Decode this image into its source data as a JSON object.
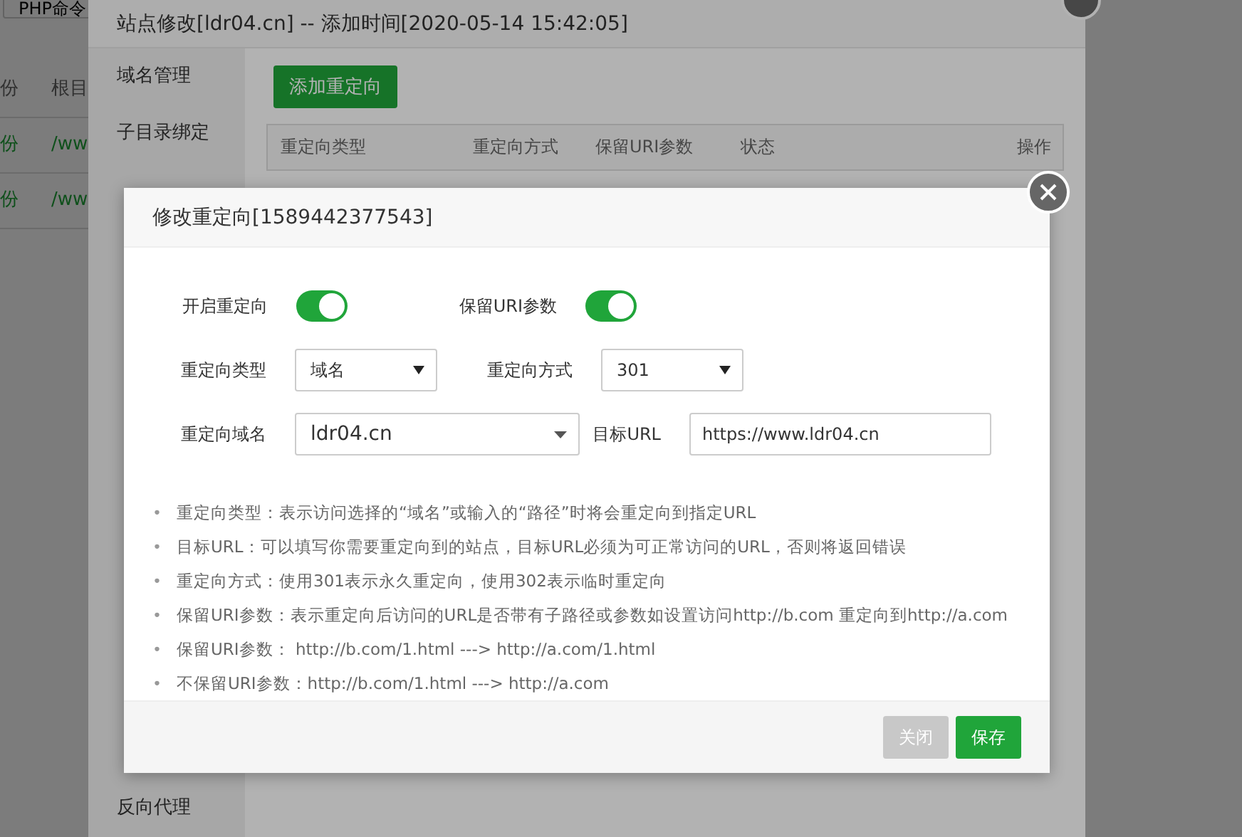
{
  "page": {
    "toolbar_button": "PHP命令",
    "columns": [
      "份",
      "根目"
    ],
    "rows": [
      {
        "cells": [
          "份",
          "/ww"
        ]
      },
      {
        "cells": [
          "份",
          "/ww"
        ]
      }
    ]
  },
  "site_dialog": {
    "title": "站点修改[ldr04.cn] -- 添加时间[2020-05-14 15:42:05]",
    "menu": [
      "域名管理",
      "子目录绑定",
      "反向代理"
    ],
    "add_button": "添加重定向",
    "table_columns": [
      "重定向类型",
      "重定向方式",
      "保留URI参数",
      "状态",
      "操作"
    ]
  },
  "redirect_dialog": {
    "title": "修改重定向[1589442377543]",
    "toggles": [
      {
        "label": "开启重定向",
        "on": true
      },
      {
        "label": "保留URI参数",
        "on": true
      }
    ],
    "type_label": "重定向类型",
    "type_value": "域名",
    "method_label": "重定向方式",
    "method_value": "301",
    "domain_label": "重定向域名",
    "domain_value": "ldr04.cn",
    "target_label": "目标URL",
    "target_value": "https://www.ldr04.cn",
    "notes": [
      {
        "marker": "•",
        "text": "重定向类型：表示访问选择的“域名”或输入的“路径”时将会重定向到指定URL"
      },
      {
        "marker": "•",
        "text": "目标URL：可以填写你需要重定向到的站点，目标URL必须为可正常访问的URL，否则将返回错误"
      },
      {
        "marker": "•",
        "text": "重定向方式：使用301表示永久重定向，使用302表示临时重定向"
      },
      {
        "marker": "•",
        "text": "保留URI参数：表示重定向后访问的URL是否带有子路径或参数如设置访问http://b.com 重定向到http://a.com"
      },
      {
        "marker": "•",
        "text": "保留URI参数：  http://b.com/1.html ---> http://a.com/1.html"
      },
      {
        "marker": "•",
        "text": "不保留URI参数：http://b.com/1.html ---> http://a.com"
      }
    ],
    "buttons": [
      {
        "label": "关闭",
        "kind": "secondary"
      },
      {
        "label": "保存",
        "kind": "primary"
      }
    ]
  }
}
